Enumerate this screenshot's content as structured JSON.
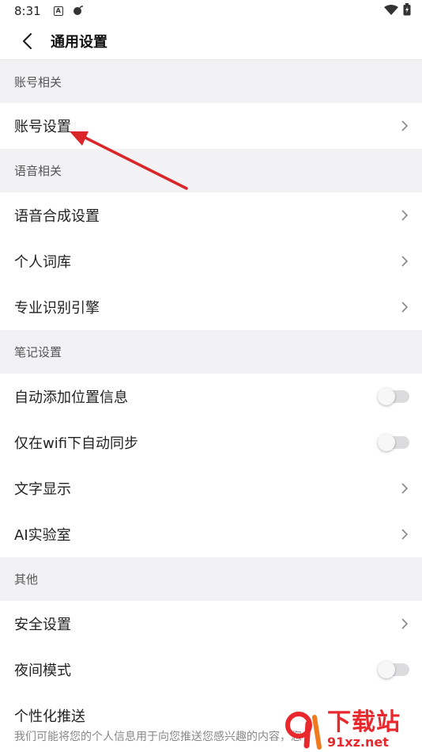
{
  "status_bar": {
    "time": "8:31",
    "notif_a": "A"
  },
  "header": {
    "title": "通用设置"
  },
  "sections": [
    {
      "title": "账号相关",
      "items": [
        {
          "label": "账号设置",
          "control": "chevron"
        }
      ]
    },
    {
      "title": "语音相关",
      "items": [
        {
          "label": "语音合成设置",
          "control": "chevron"
        },
        {
          "label": "个人词库",
          "control": "chevron"
        },
        {
          "label": "专业识别引擎",
          "control": "chevron"
        }
      ]
    },
    {
      "title": "笔记设置",
      "items": [
        {
          "label": "自动添加位置信息",
          "control": "toggle",
          "on": false
        },
        {
          "label": "仅在wifi下自动同步",
          "control": "toggle",
          "on": false
        },
        {
          "label": "文字显示",
          "control": "chevron"
        },
        {
          "label": "AI实验室",
          "control": "chevron"
        }
      ]
    },
    {
      "title": "其他",
      "items": [
        {
          "label": "安全设置",
          "control": "chevron"
        },
        {
          "label": "夜间模式",
          "control": "toggle",
          "on": false
        },
        {
          "label": "个性化推送",
          "control": "none"
        }
      ]
    }
  ],
  "personalized_desc": "我们可能将您的个人信息用于向您推送您感兴趣的内容，您",
  "watermark": {
    "main": "下载站",
    "sub": "91xz.net"
  },
  "colors": {
    "annotation_arrow": "#d9262b",
    "toggle_track": "#dcdcde",
    "background": "#f2f2f4"
  }
}
